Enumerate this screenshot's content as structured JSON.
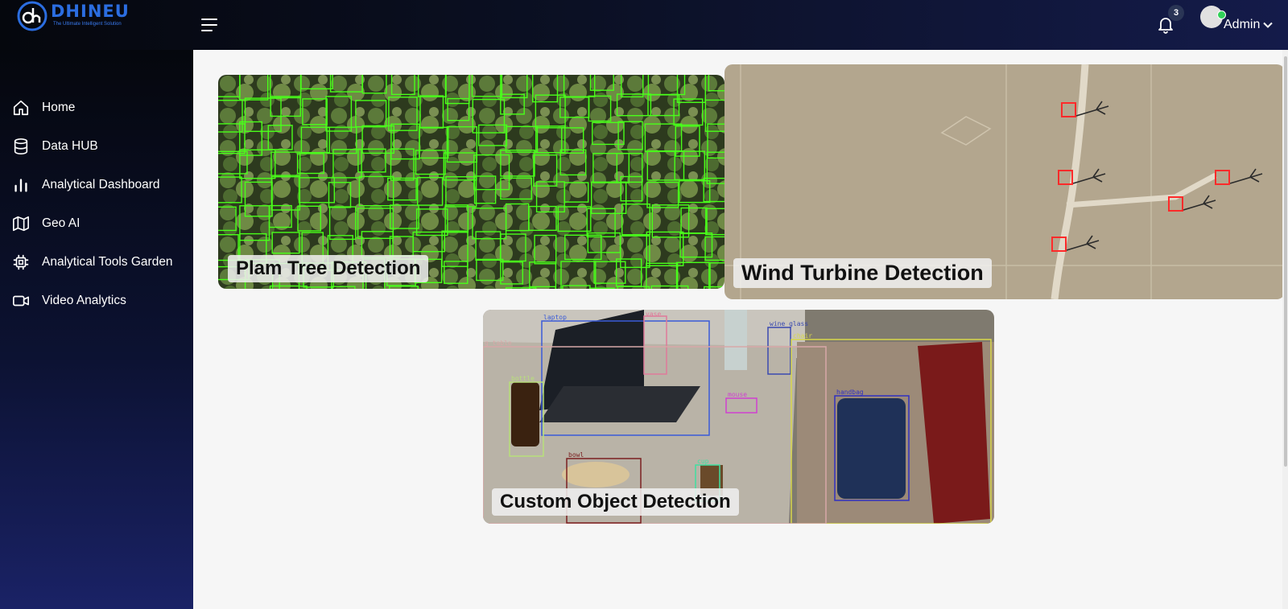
{
  "brand": {
    "name": "DHINEU",
    "tagline": "The Ultimate Intelligent Solution"
  },
  "header": {
    "menu_icon": "hamburger-icon",
    "notifications": {
      "icon": "bell-icon",
      "count": "3"
    },
    "user": {
      "name": "Admin",
      "icon": "chevron-down-icon",
      "status_color": "#31d158"
    }
  },
  "sidebar": {
    "items": [
      {
        "label": "Home",
        "icon": "home-icon"
      },
      {
        "label": "Data HUB",
        "icon": "database-icon"
      },
      {
        "label": "Analytical Dashboard",
        "icon": "bar-chart-icon"
      },
      {
        "label": "Geo AI",
        "icon": "map-icon"
      },
      {
        "label": "Analytical Tools Garden",
        "icon": "chip-icon"
      },
      {
        "label": "Video Analytics",
        "icon": "video-icon"
      }
    ]
  },
  "cards": [
    {
      "title": "Plam Tree Detection",
      "box_color": "#49ff1a"
    },
    {
      "title": "Wind Turbine Detection",
      "box_color": "#ff2a2a"
    },
    {
      "title": "Custom Object Detection",
      "detections": [
        "laptop",
        "vase",
        "wine_glass",
        "chair",
        "g_table",
        "bottle",
        "mouse",
        "handbag",
        "bowl",
        "cup"
      ]
    }
  ],
  "colors": {
    "topbar": "#0b1024",
    "sidebar": "#0c1232",
    "content_bg": "#f6f6f6"
  }
}
